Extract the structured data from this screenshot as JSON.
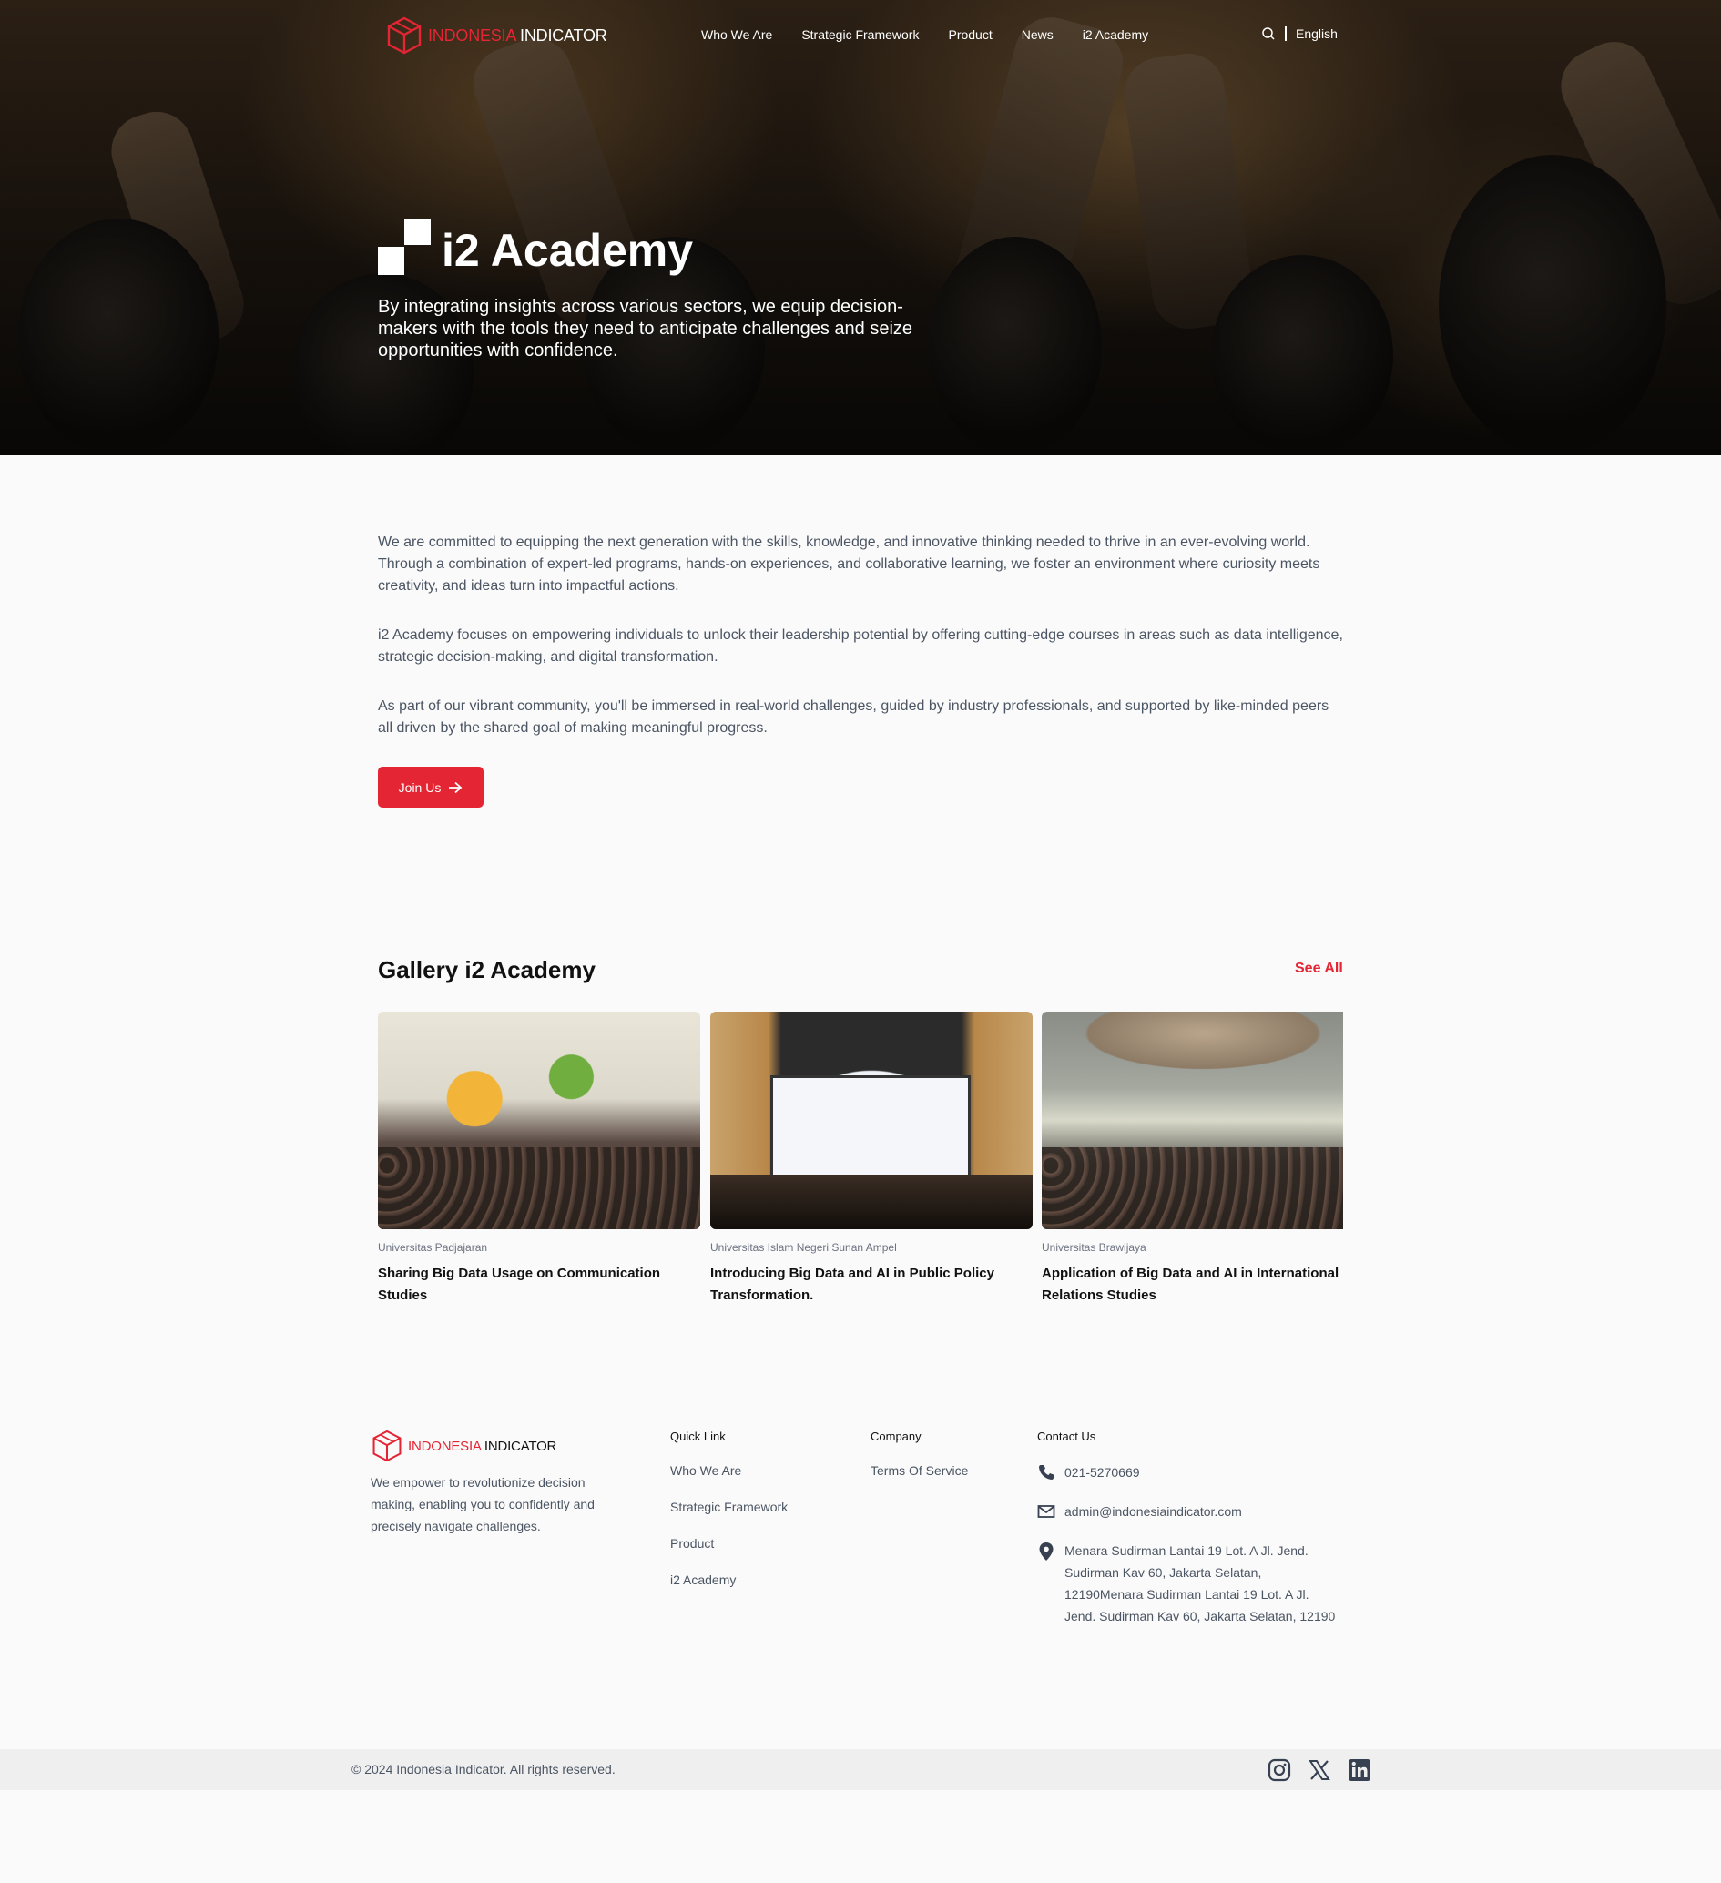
{
  "brand": {
    "name_red": "INDONESIA",
    "name_dark": "INDICATOR"
  },
  "nav": {
    "links": [
      "Who We Are",
      "Strategic Framework",
      "Product",
      "News",
      "i2 Academy"
    ],
    "language": "English"
  },
  "hero": {
    "title": "i2 Academy",
    "subtitle": "By integrating insights across various sectors, we equip decision-makers with the tools they need to anticipate challenges and seize opportunities with confidence."
  },
  "intro": {
    "paragraphs": [
      "We are committed to equipping the next generation with the skills, knowledge, and innovative thinking needed to thrive in an ever-evolving world. Through a combination of expert-led programs, hands-on experiences, and collaborative learning, we foster an environment where curiosity meets creativity, and ideas turn into impactful actions.",
      "i2 Academy focuses on empowering individuals to unlock their leadership potential by offering cutting-edge courses in areas such as data intelligence, strategic decision-making, and digital transformation.",
      "As part of our vibrant community, you'll be immersed in real-world challenges, guided by industry professionals, and supported by like-minded peers all driven by the shared goal of making meaningful progress."
    ],
    "cta": "Join Us"
  },
  "gallery": {
    "title": "Gallery i2 Academy",
    "see_all": "See All",
    "items": [
      {
        "source": "Universitas Padjajaran",
        "title": "Sharing Big Data Usage on Communication Studies"
      },
      {
        "source": "Universitas Islam Negeri Sunan Ampel",
        "title": "Introducing Big Data and AI in Public Policy Transformation."
      },
      {
        "source": "Universitas Brawijaya",
        "title": "Application of Big Data and AI in International Relations Studies"
      }
    ]
  },
  "footer": {
    "description": "We empower to revolutionize decision making, enabling you to confidently and precisely navigate challenges.",
    "quick_link": {
      "heading": "Quick Link",
      "items": [
        "Who We Are",
        "Strategic Framework",
        "Product",
        "i2 Academy"
      ]
    },
    "company": {
      "heading": "Company",
      "items": [
        "Terms Of Service"
      ]
    },
    "contact": {
      "heading": "Contact Us",
      "phone": "021-5270669",
      "email": "admin@indonesiaindicator.com",
      "address": "Menara Sudirman Lantai 19 Lot. A Jl. Jend. Sudirman Kav 60, Jakarta Selatan, 12190Menara Sudirman Lantai 19 Lot. A Jl. Jend. Sudirman Kav 60, Jakarta Selatan, 12190"
    },
    "copyright": "© 2024 Indonesia Indicator. All rights reserved.",
    "socials": [
      "instagram-icon",
      "x-icon",
      "linkedin-icon"
    ]
  },
  "colors": {
    "accent": "#e42533",
    "text_muted": "#4b5563",
    "footer_bar": "#efefef"
  }
}
